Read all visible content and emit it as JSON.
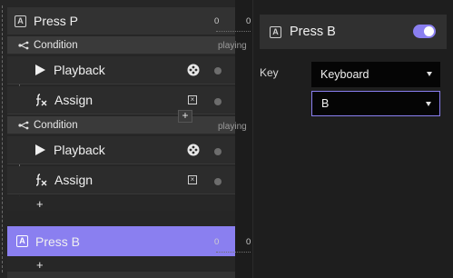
{
  "tree": {
    "press_p": {
      "title": "Press P",
      "badge": "A"
    },
    "conditions": [
      {
        "label": "Condition",
        "actions": [
          {
            "label": "Playback"
          },
          {
            "label": "Assign"
          }
        ]
      },
      {
        "label": "Condition",
        "actions": [
          {
            "label": "Playback"
          },
          {
            "label": "Assign"
          }
        ]
      }
    ],
    "press_b": {
      "title": "Press B",
      "badge": "A"
    },
    "add_symbol": "+"
  },
  "timeline": {
    "zero": "0",
    "playing": "playing"
  },
  "inspector": {
    "title": "Press B",
    "badge": "A",
    "enabled": true,
    "key_label": "Key",
    "device_value": "Keyboard",
    "key_value": "B"
  },
  "colors": {
    "accent": "#8a7ff0",
    "panel": "#262626",
    "row_header": "#323232"
  }
}
